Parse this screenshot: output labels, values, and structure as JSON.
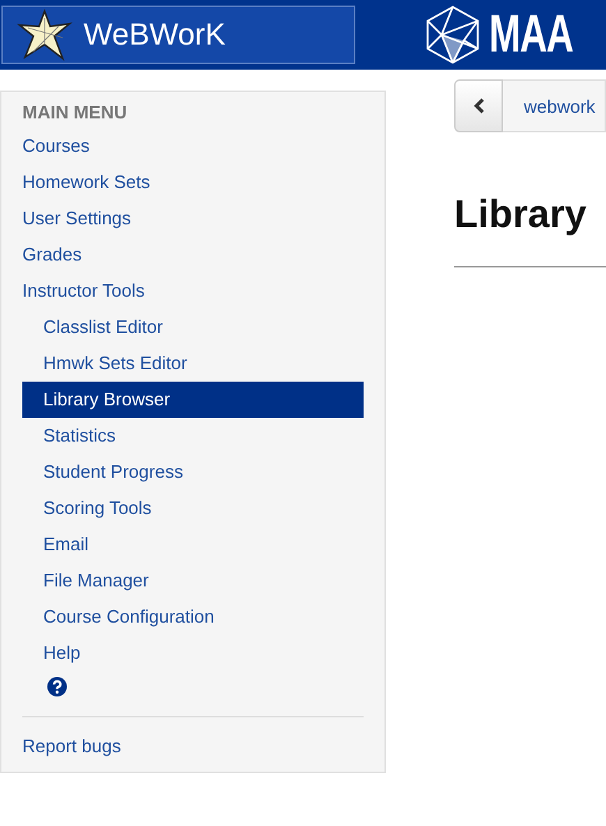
{
  "header": {
    "title": "WeBWorK",
    "partner": "MAA"
  },
  "sidebar": {
    "heading": "MAIN MENU",
    "items": [
      {
        "label": "Courses",
        "selected": false
      },
      {
        "label": "Homework Sets",
        "selected": false
      },
      {
        "label": "User Settings",
        "selected": false
      },
      {
        "label": "Grades",
        "selected": false
      },
      {
        "label": "Instructor Tools",
        "selected": false,
        "children": [
          {
            "label": "Classlist Editor",
            "selected": false
          },
          {
            "label": "Hmwk Sets Editor",
            "selected": false
          },
          {
            "label": "Library Browser",
            "selected": true
          },
          {
            "label": "Statistics",
            "selected": false
          },
          {
            "label": "Student Progress",
            "selected": false
          },
          {
            "label": "Scoring Tools",
            "selected": false
          },
          {
            "label": "Email",
            "selected": false
          },
          {
            "label": "File Manager",
            "selected": false
          },
          {
            "label": "Course Configuration",
            "selected": false
          },
          {
            "label": "Help",
            "selected": false,
            "kind": "help"
          }
        ]
      }
    ],
    "footer_link": "Report bugs"
  },
  "main": {
    "breadcrumb": "webwork",
    "page_title": "Library"
  }
}
